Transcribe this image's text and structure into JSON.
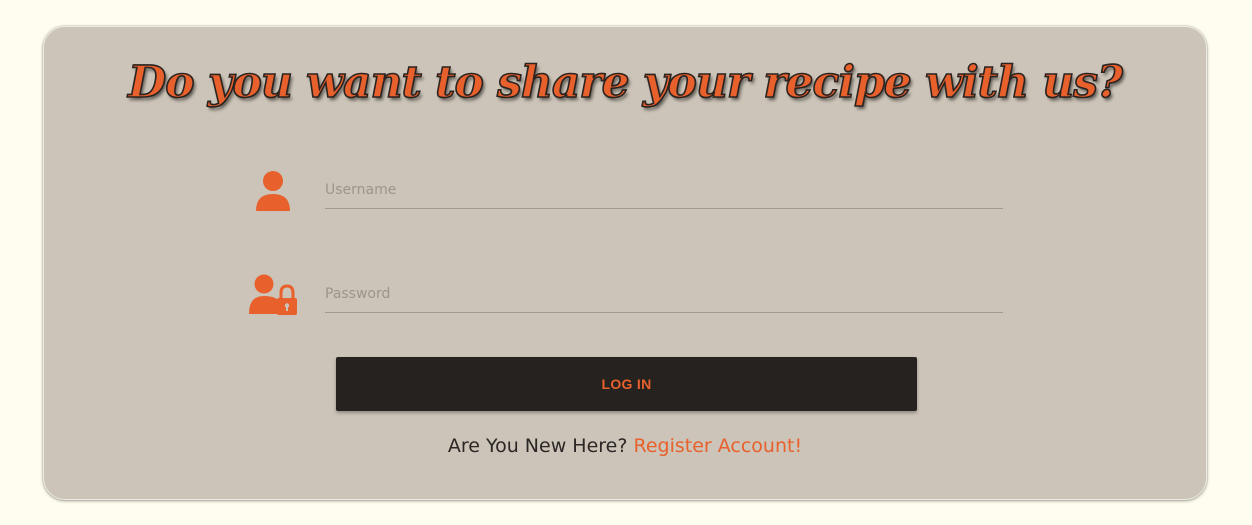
{
  "page": {
    "title": "Do you want to share your recipe with us?"
  },
  "form": {
    "username": {
      "placeholder": "Username",
      "value": "",
      "icon": "user-icon"
    },
    "password": {
      "placeholder": "Password",
      "value": "",
      "icon": "user-lock-icon"
    },
    "login_label": "LOG IN"
  },
  "register": {
    "prompt": "Are You New Here?",
    "link_label": "Register Account!"
  },
  "colors": {
    "accent": "#e8602c",
    "card_background": "#ccc4b8",
    "page_background": "#fffdef",
    "button_background": "#252220"
  }
}
